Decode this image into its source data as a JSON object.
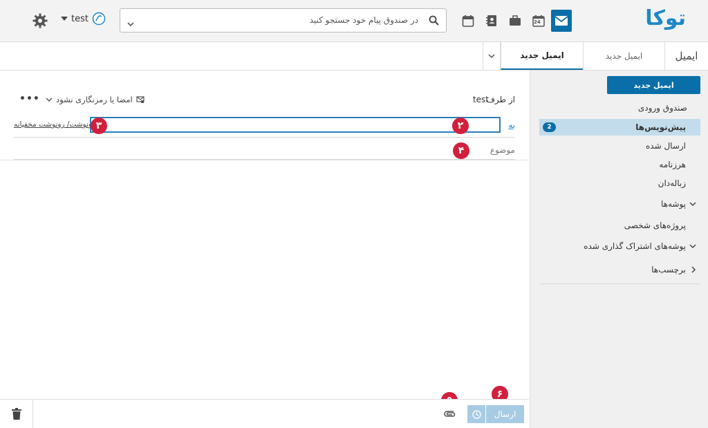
{
  "brand": {
    "logo_text": "توکا",
    "accent": "#0a6fa8",
    "marker_color": "#d21f3c"
  },
  "topbar": {
    "search_placeholder": "در صندوق پیام خود جستجو کنید",
    "username": "test",
    "calendar_day": "24"
  },
  "tabs": {
    "module_title": "ایمیل",
    "items": [
      {
        "label": "ایمیل جدید",
        "active": false
      },
      {
        "label": "ایمیل جدید",
        "active": true
      }
    ]
  },
  "sidebar": {
    "new_mail_label": "ایمیل جدید",
    "folders": [
      {
        "label": "صندوق ورودی"
      },
      {
        "label": "پیش‌نویس‌ها",
        "badge": "2",
        "active": true
      },
      {
        "label": "ارسال شده"
      },
      {
        "label": "هرزنامه"
      },
      {
        "label": "زباله‌دان"
      },
      {
        "label": "پوشه‌ها"
      },
      {
        "label": "پروژه‌های شخصی"
      },
      {
        "label": "پوشه‌های اشتراک گذاری شده"
      },
      {
        "label": "برچسب‌ها"
      }
    ]
  },
  "compose": {
    "from_label": "از طرف",
    "from_value": "test",
    "sign_encrypt_label": "امضا یا رمزنگاری نشود",
    "to_label": "به",
    "cc_bcc_label": "رونوشت/ رونوشت مخفیانه",
    "subject_label": "موضوع"
  },
  "bottombar": {
    "send_label": "ارسال"
  },
  "markers": [
    "۲",
    "۳",
    "۴",
    "۵",
    "۶"
  ]
}
